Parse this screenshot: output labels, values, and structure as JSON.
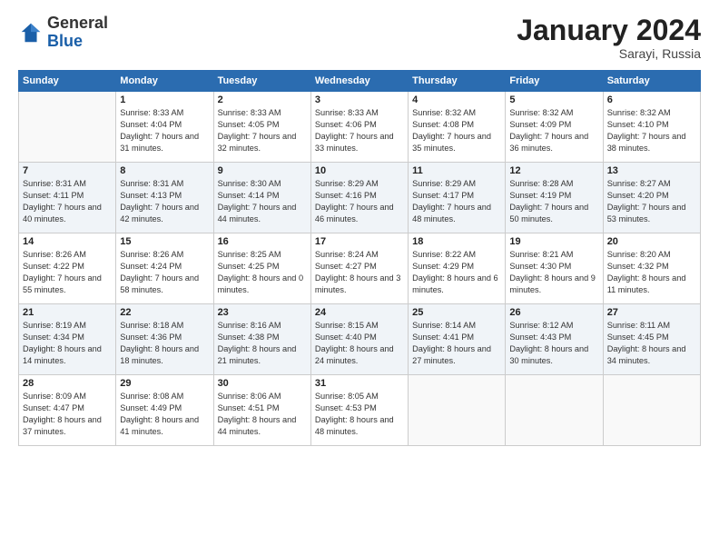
{
  "logo": {
    "general": "General",
    "blue": "Blue"
  },
  "header": {
    "month": "January 2024",
    "location": "Sarayi, Russia"
  },
  "weekdays": [
    "Sunday",
    "Monday",
    "Tuesday",
    "Wednesday",
    "Thursday",
    "Friday",
    "Saturday"
  ],
  "weeks": [
    [
      {
        "day": "",
        "sunrise": "",
        "sunset": "",
        "daylight": ""
      },
      {
        "day": "1",
        "sunrise": "Sunrise: 8:33 AM",
        "sunset": "Sunset: 4:04 PM",
        "daylight": "Daylight: 7 hours and 31 minutes."
      },
      {
        "day": "2",
        "sunrise": "Sunrise: 8:33 AM",
        "sunset": "Sunset: 4:05 PM",
        "daylight": "Daylight: 7 hours and 32 minutes."
      },
      {
        "day": "3",
        "sunrise": "Sunrise: 8:33 AM",
        "sunset": "Sunset: 4:06 PM",
        "daylight": "Daylight: 7 hours and 33 minutes."
      },
      {
        "day": "4",
        "sunrise": "Sunrise: 8:32 AM",
        "sunset": "Sunset: 4:08 PM",
        "daylight": "Daylight: 7 hours and 35 minutes."
      },
      {
        "day": "5",
        "sunrise": "Sunrise: 8:32 AM",
        "sunset": "Sunset: 4:09 PM",
        "daylight": "Daylight: 7 hours and 36 minutes."
      },
      {
        "day": "6",
        "sunrise": "Sunrise: 8:32 AM",
        "sunset": "Sunset: 4:10 PM",
        "daylight": "Daylight: 7 hours and 38 minutes."
      }
    ],
    [
      {
        "day": "7",
        "sunrise": "Sunrise: 8:31 AM",
        "sunset": "Sunset: 4:11 PM",
        "daylight": "Daylight: 7 hours and 40 minutes."
      },
      {
        "day": "8",
        "sunrise": "Sunrise: 8:31 AM",
        "sunset": "Sunset: 4:13 PM",
        "daylight": "Daylight: 7 hours and 42 minutes."
      },
      {
        "day": "9",
        "sunrise": "Sunrise: 8:30 AM",
        "sunset": "Sunset: 4:14 PM",
        "daylight": "Daylight: 7 hours and 44 minutes."
      },
      {
        "day": "10",
        "sunrise": "Sunrise: 8:29 AM",
        "sunset": "Sunset: 4:16 PM",
        "daylight": "Daylight: 7 hours and 46 minutes."
      },
      {
        "day": "11",
        "sunrise": "Sunrise: 8:29 AM",
        "sunset": "Sunset: 4:17 PM",
        "daylight": "Daylight: 7 hours and 48 minutes."
      },
      {
        "day": "12",
        "sunrise": "Sunrise: 8:28 AM",
        "sunset": "Sunset: 4:19 PM",
        "daylight": "Daylight: 7 hours and 50 minutes."
      },
      {
        "day": "13",
        "sunrise": "Sunrise: 8:27 AM",
        "sunset": "Sunset: 4:20 PM",
        "daylight": "Daylight: 7 hours and 53 minutes."
      }
    ],
    [
      {
        "day": "14",
        "sunrise": "Sunrise: 8:26 AM",
        "sunset": "Sunset: 4:22 PM",
        "daylight": "Daylight: 7 hours and 55 minutes."
      },
      {
        "day": "15",
        "sunrise": "Sunrise: 8:26 AM",
        "sunset": "Sunset: 4:24 PM",
        "daylight": "Daylight: 7 hours and 58 minutes."
      },
      {
        "day": "16",
        "sunrise": "Sunrise: 8:25 AM",
        "sunset": "Sunset: 4:25 PM",
        "daylight": "Daylight: 8 hours and 0 minutes."
      },
      {
        "day": "17",
        "sunrise": "Sunrise: 8:24 AM",
        "sunset": "Sunset: 4:27 PM",
        "daylight": "Daylight: 8 hours and 3 minutes."
      },
      {
        "day": "18",
        "sunrise": "Sunrise: 8:22 AM",
        "sunset": "Sunset: 4:29 PM",
        "daylight": "Daylight: 8 hours and 6 minutes."
      },
      {
        "day": "19",
        "sunrise": "Sunrise: 8:21 AM",
        "sunset": "Sunset: 4:30 PM",
        "daylight": "Daylight: 8 hours and 9 minutes."
      },
      {
        "day": "20",
        "sunrise": "Sunrise: 8:20 AM",
        "sunset": "Sunset: 4:32 PM",
        "daylight": "Daylight: 8 hours and 11 minutes."
      }
    ],
    [
      {
        "day": "21",
        "sunrise": "Sunrise: 8:19 AM",
        "sunset": "Sunset: 4:34 PM",
        "daylight": "Daylight: 8 hours and 14 minutes."
      },
      {
        "day": "22",
        "sunrise": "Sunrise: 8:18 AM",
        "sunset": "Sunset: 4:36 PM",
        "daylight": "Daylight: 8 hours and 18 minutes."
      },
      {
        "day": "23",
        "sunrise": "Sunrise: 8:16 AM",
        "sunset": "Sunset: 4:38 PM",
        "daylight": "Daylight: 8 hours and 21 minutes."
      },
      {
        "day": "24",
        "sunrise": "Sunrise: 8:15 AM",
        "sunset": "Sunset: 4:40 PM",
        "daylight": "Daylight: 8 hours and 24 minutes."
      },
      {
        "day": "25",
        "sunrise": "Sunrise: 8:14 AM",
        "sunset": "Sunset: 4:41 PM",
        "daylight": "Daylight: 8 hours and 27 minutes."
      },
      {
        "day": "26",
        "sunrise": "Sunrise: 8:12 AM",
        "sunset": "Sunset: 4:43 PM",
        "daylight": "Daylight: 8 hours and 30 minutes."
      },
      {
        "day": "27",
        "sunrise": "Sunrise: 8:11 AM",
        "sunset": "Sunset: 4:45 PM",
        "daylight": "Daylight: 8 hours and 34 minutes."
      }
    ],
    [
      {
        "day": "28",
        "sunrise": "Sunrise: 8:09 AM",
        "sunset": "Sunset: 4:47 PM",
        "daylight": "Daylight: 8 hours and 37 minutes."
      },
      {
        "day": "29",
        "sunrise": "Sunrise: 8:08 AM",
        "sunset": "Sunset: 4:49 PM",
        "daylight": "Daylight: 8 hours and 41 minutes."
      },
      {
        "day": "30",
        "sunrise": "Sunrise: 8:06 AM",
        "sunset": "Sunset: 4:51 PM",
        "daylight": "Daylight: 8 hours and 44 minutes."
      },
      {
        "day": "31",
        "sunrise": "Sunrise: 8:05 AM",
        "sunset": "Sunset: 4:53 PM",
        "daylight": "Daylight: 8 hours and 48 minutes."
      },
      {
        "day": "",
        "sunrise": "",
        "sunset": "",
        "daylight": ""
      },
      {
        "day": "",
        "sunrise": "",
        "sunset": "",
        "daylight": ""
      },
      {
        "day": "",
        "sunrise": "",
        "sunset": "",
        "daylight": ""
      }
    ]
  ]
}
